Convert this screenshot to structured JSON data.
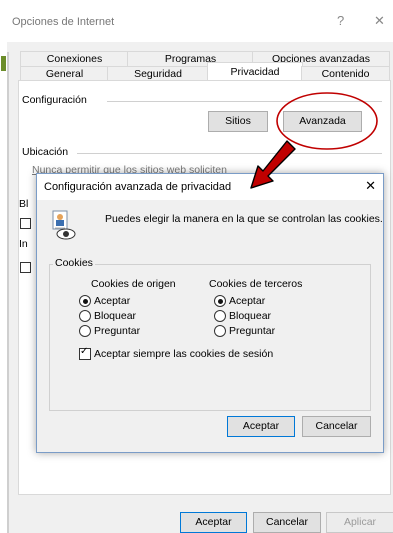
{
  "window": {
    "title": "Opciones de Internet",
    "help_glyph": "?",
    "close_glyph": "✕"
  },
  "tabs_top": [
    "Conexiones",
    "Programas",
    "Opciones avanzadas"
  ],
  "tabs_bottom": [
    "General",
    "Seguridad",
    "Privacidad",
    "Contenido"
  ],
  "privacy": {
    "config_label": "Configuración",
    "sites_button": "Sitios",
    "advanced_button": "Avanzada",
    "location_label": "Ubicación",
    "location_cut_text": "Nunca permitir que los sitios web soliciten",
    "side_letter_1": "Bl",
    "side_letter_2": "In"
  },
  "dialog": {
    "title": "Configuración avanzada de privacidad",
    "close_glyph": "✕",
    "intro": "Puedes elegir la manera en la que se controlan las cookies.",
    "group_label": "Cookies",
    "first_party": {
      "heading": "Cookies de origen",
      "options": [
        "Aceptar",
        "Bloquear",
        "Preguntar"
      ],
      "selected": 0
    },
    "third_party": {
      "heading": "Cookies de terceros",
      "options": [
        "Aceptar",
        "Bloquear",
        "Preguntar"
      ],
      "selected": 0
    },
    "session_checkbox": "Aceptar siempre las cookies de sesión",
    "session_checked": true,
    "ok_button": "Aceptar",
    "cancel_button": "Cancelar"
  },
  "footer": {
    "ok": "Aceptar",
    "cancel": "Cancelar",
    "apply": "Aplicar"
  },
  "colors": {
    "annotation_red": "#c00000",
    "accent_blue": "#0078d7"
  }
}
